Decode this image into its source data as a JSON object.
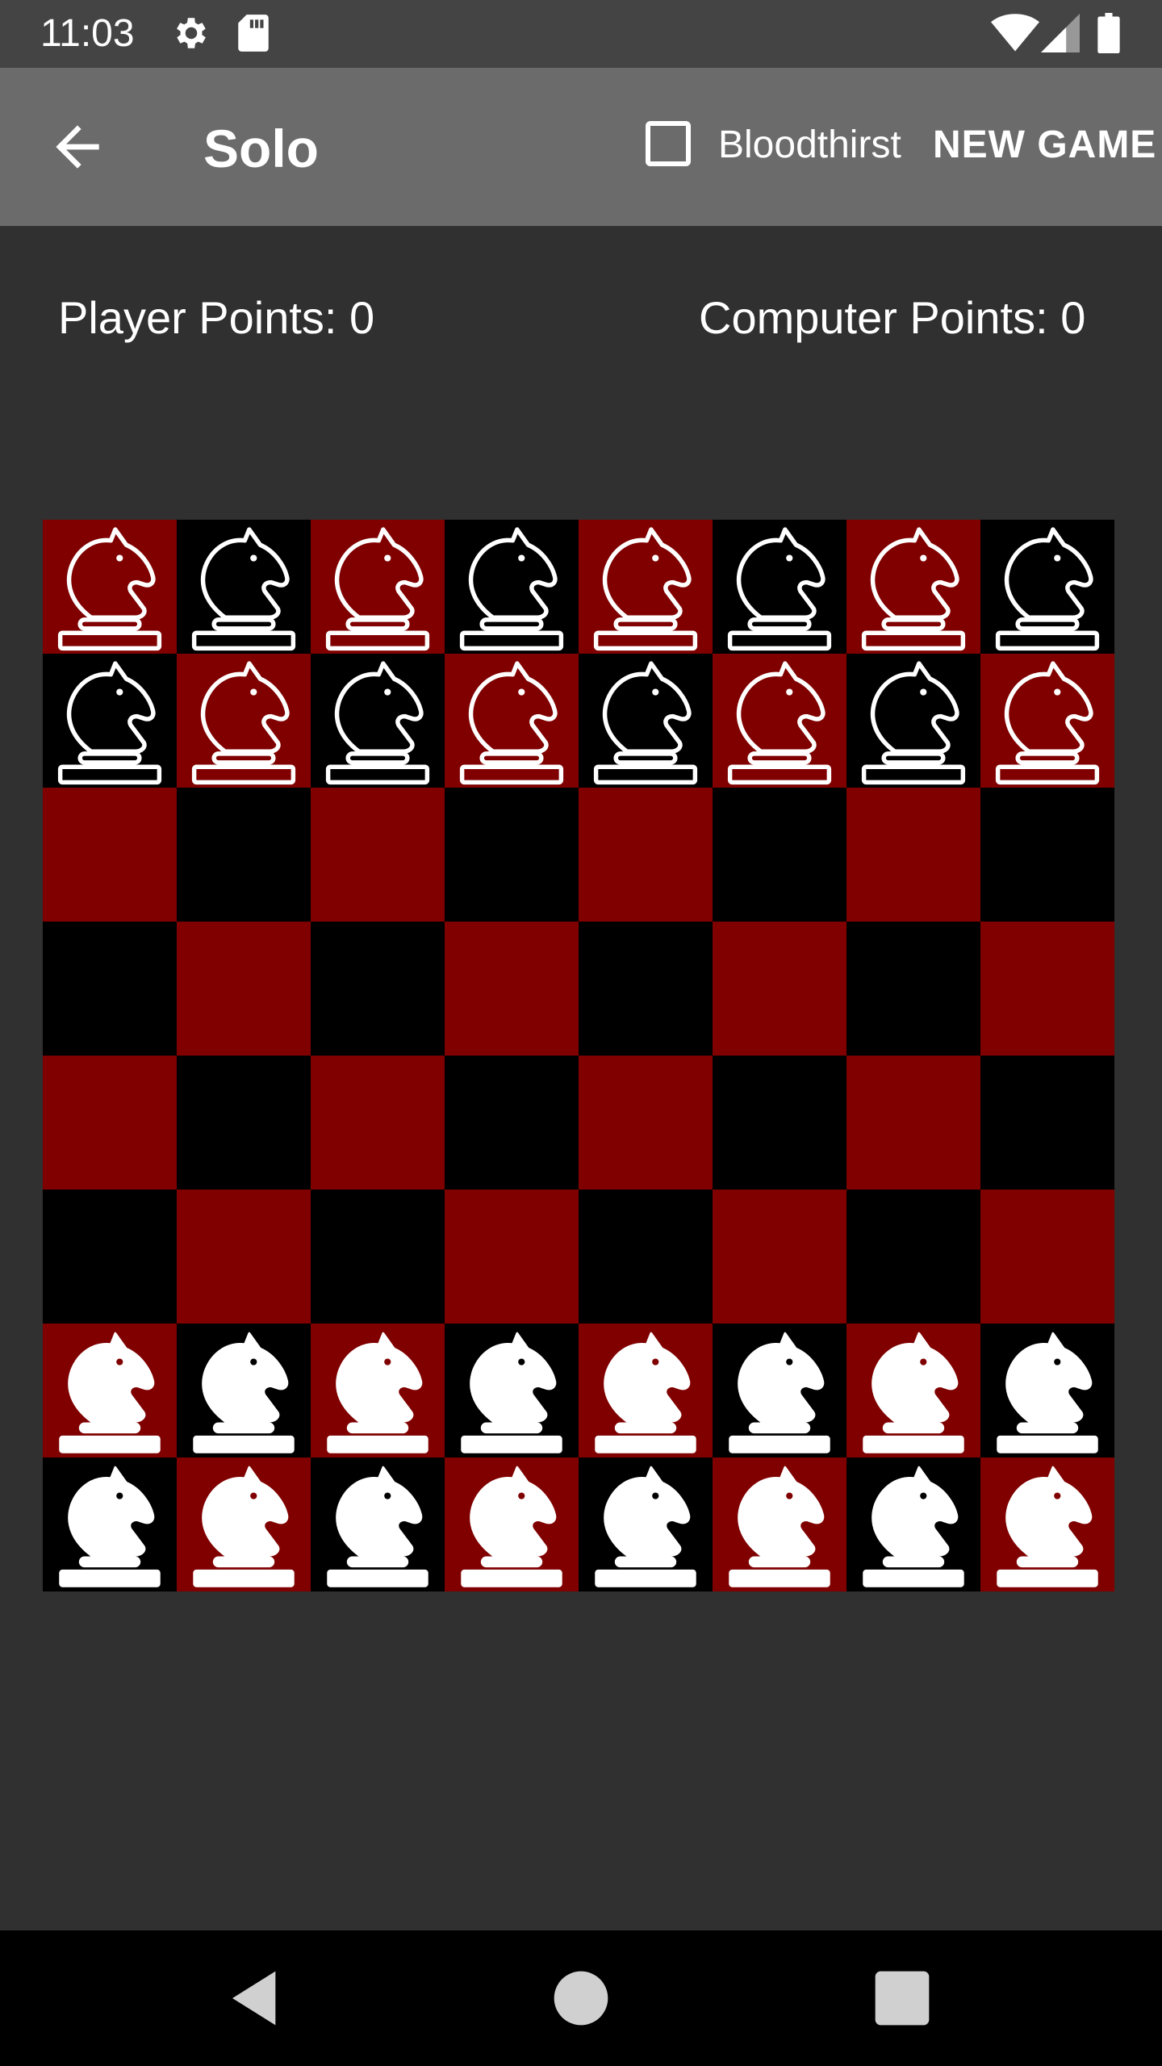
{
  "status_bar": {
    "time": "11:03",
    "icons": [
      "gear-icon",
      "sd-card-icon",
      "wifi-icon",
      "signal-icon",
      "battery-icon"
    ]
  },
  "app_bar": {
    "back_icon": "arrow-back-icon",
    "title": "Solo",
    "checkbox_label": "Bloodthirst",
    "checkbox_checked": false,
    "new_game_label": "NEW GAME"
  },
  "scores": {
    "player": "Player Points: 0",
    "computer": "Computer Points: 0"
  },
  "board": {
    "light_color": "#800000",
    "dark_color": "#000000",
    "rows": [
      [
        "bN",
        "bN",
        "bN",
        "bN",
        "bN",
        "bN",
        "bN",
        "bN"
      ],
      [
        "bN",
        "bN",
        "bN",
        "bN",
        "bN",
        "bN",
        "bN",
        "bN"
      ],
      [
        "",
        "",
        "",
        "",
        "",
        "",
        "",
        ""
      ],
      [
        "",
        "",
        "",
        "",
        "",
        "",
        "",
        ""
      ],
      [
        "",
        "",
        "",
        "",
        "",
        "",
        "",
        ""
      ],
      [
        "",
        "",
        "",
        "",
        "",
        "",
        "",
        ""
      ],
      [
        "wN",
        "wN",
        "wN",
        "wN",
        "wN",
        "wN",
        "wN",
        "wN"
      ],
      [
        "wN",
        "wN",
        "wN",
        "wN",
        "wN",
        "wN",
        "wN",
        "wN"
      ]
    ]
  },
  "nav_bar": {
    "icons": [
      "nav-back-icon",
      "nav-home-icon",
      "nav-recents-icon"
    ]
  }
}
